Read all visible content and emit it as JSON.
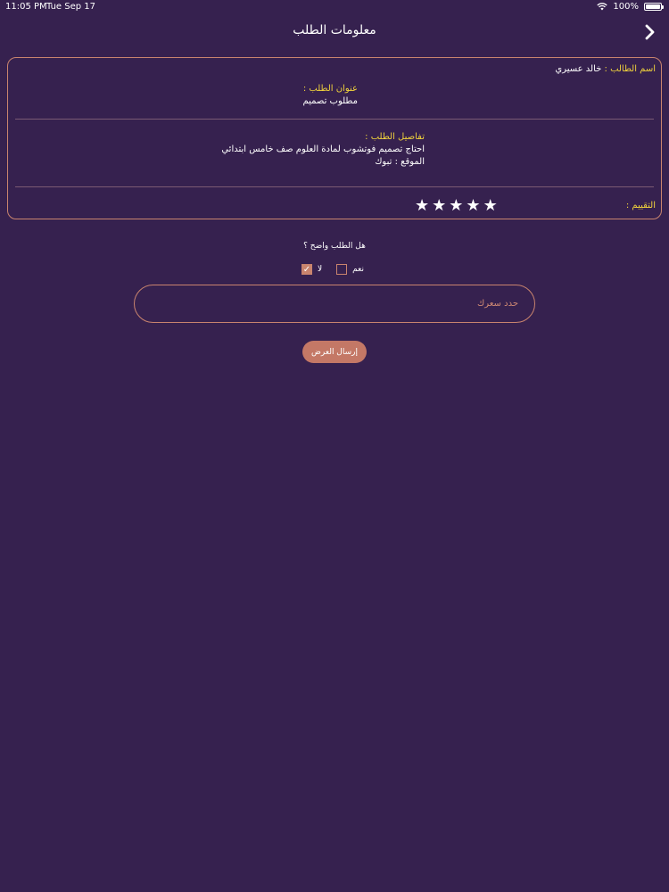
{
  "status_bar": {
    "time": "11:05 PM",
    "date": "Tue Sep 17",
    "battery": "100%"
  },
  "nav": {
    "title": "معلومات الطلب",
    "back_icon": "chevron-right-icon"
  },
  "card": {
    "student_label": "اسم الطالب :",
    "student_name": "خالد عسيري",
    "request_title_label": "عنوان الطلب :",
    "request_title": "مطلوب تصميم",
    "details_label": "تفاصيل الطلب :",
    "details": "احتاج تصميم فوتشوب لمادة العلوم صف خامس ابتدائي",
    "location": "الموقع : تبوك",
    "rating_label": "التقييم :",
    "stars": [
      "★",
      "★",
      "★",
      "★",
      "★"
    ],
    "rating": 5
  },
  "clarity": {
    "question": "هل الطلب واضح ؟",
    "yes_label": "نعم",
    "no_label": "لا",
    "selected": "no"
  },
  "price_input": {
    "placeholder": "حدد سعرك",
    "value": ""
  },
  "submit_label": "إرسال العرض",
  "colors": {
    "background": "#36214f",
    "accent": "#c9846e",
    "label": "#f0d23c"
  }
}
